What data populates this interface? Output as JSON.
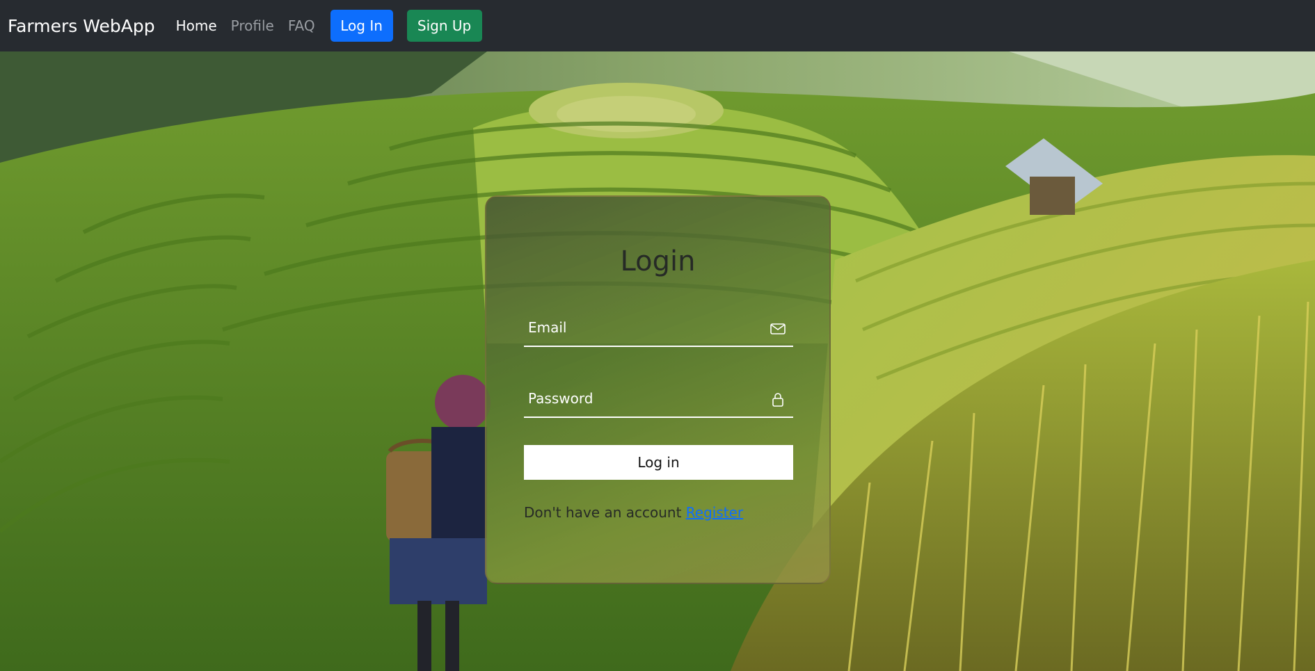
{
  "navbar": {
    "brand": "Farmers WebApp",
    "links": [
      {
        "label": "Home",
        "state": "active"
      },
      {
        "label": "Profile",
        "state": "muted"
      },
      {
        "label": "FAQ",
        "state": "muted"
      }
    ],
    "login_button": "Log In",
    "signup_button": "Sign Up"
  },
  "login_card": {
    "title": "Login",
    "email_placeholder": "Email",
    "email_icon": "envelope-icon",
    "password_placeholder": "Password",
    "password_icon": "lock-icon",
    "submit_label": "Log in",
    "register_prompt": "Don't have an account",
    "register_link": "Register"
  },
  "colors": {
    "navbar_bg": "#272b30",
    "login_button_bg": "#0d6efd",
    "signup_button_bg": "#198754",
    "link_blue": "#0d6efd"
  }
}
